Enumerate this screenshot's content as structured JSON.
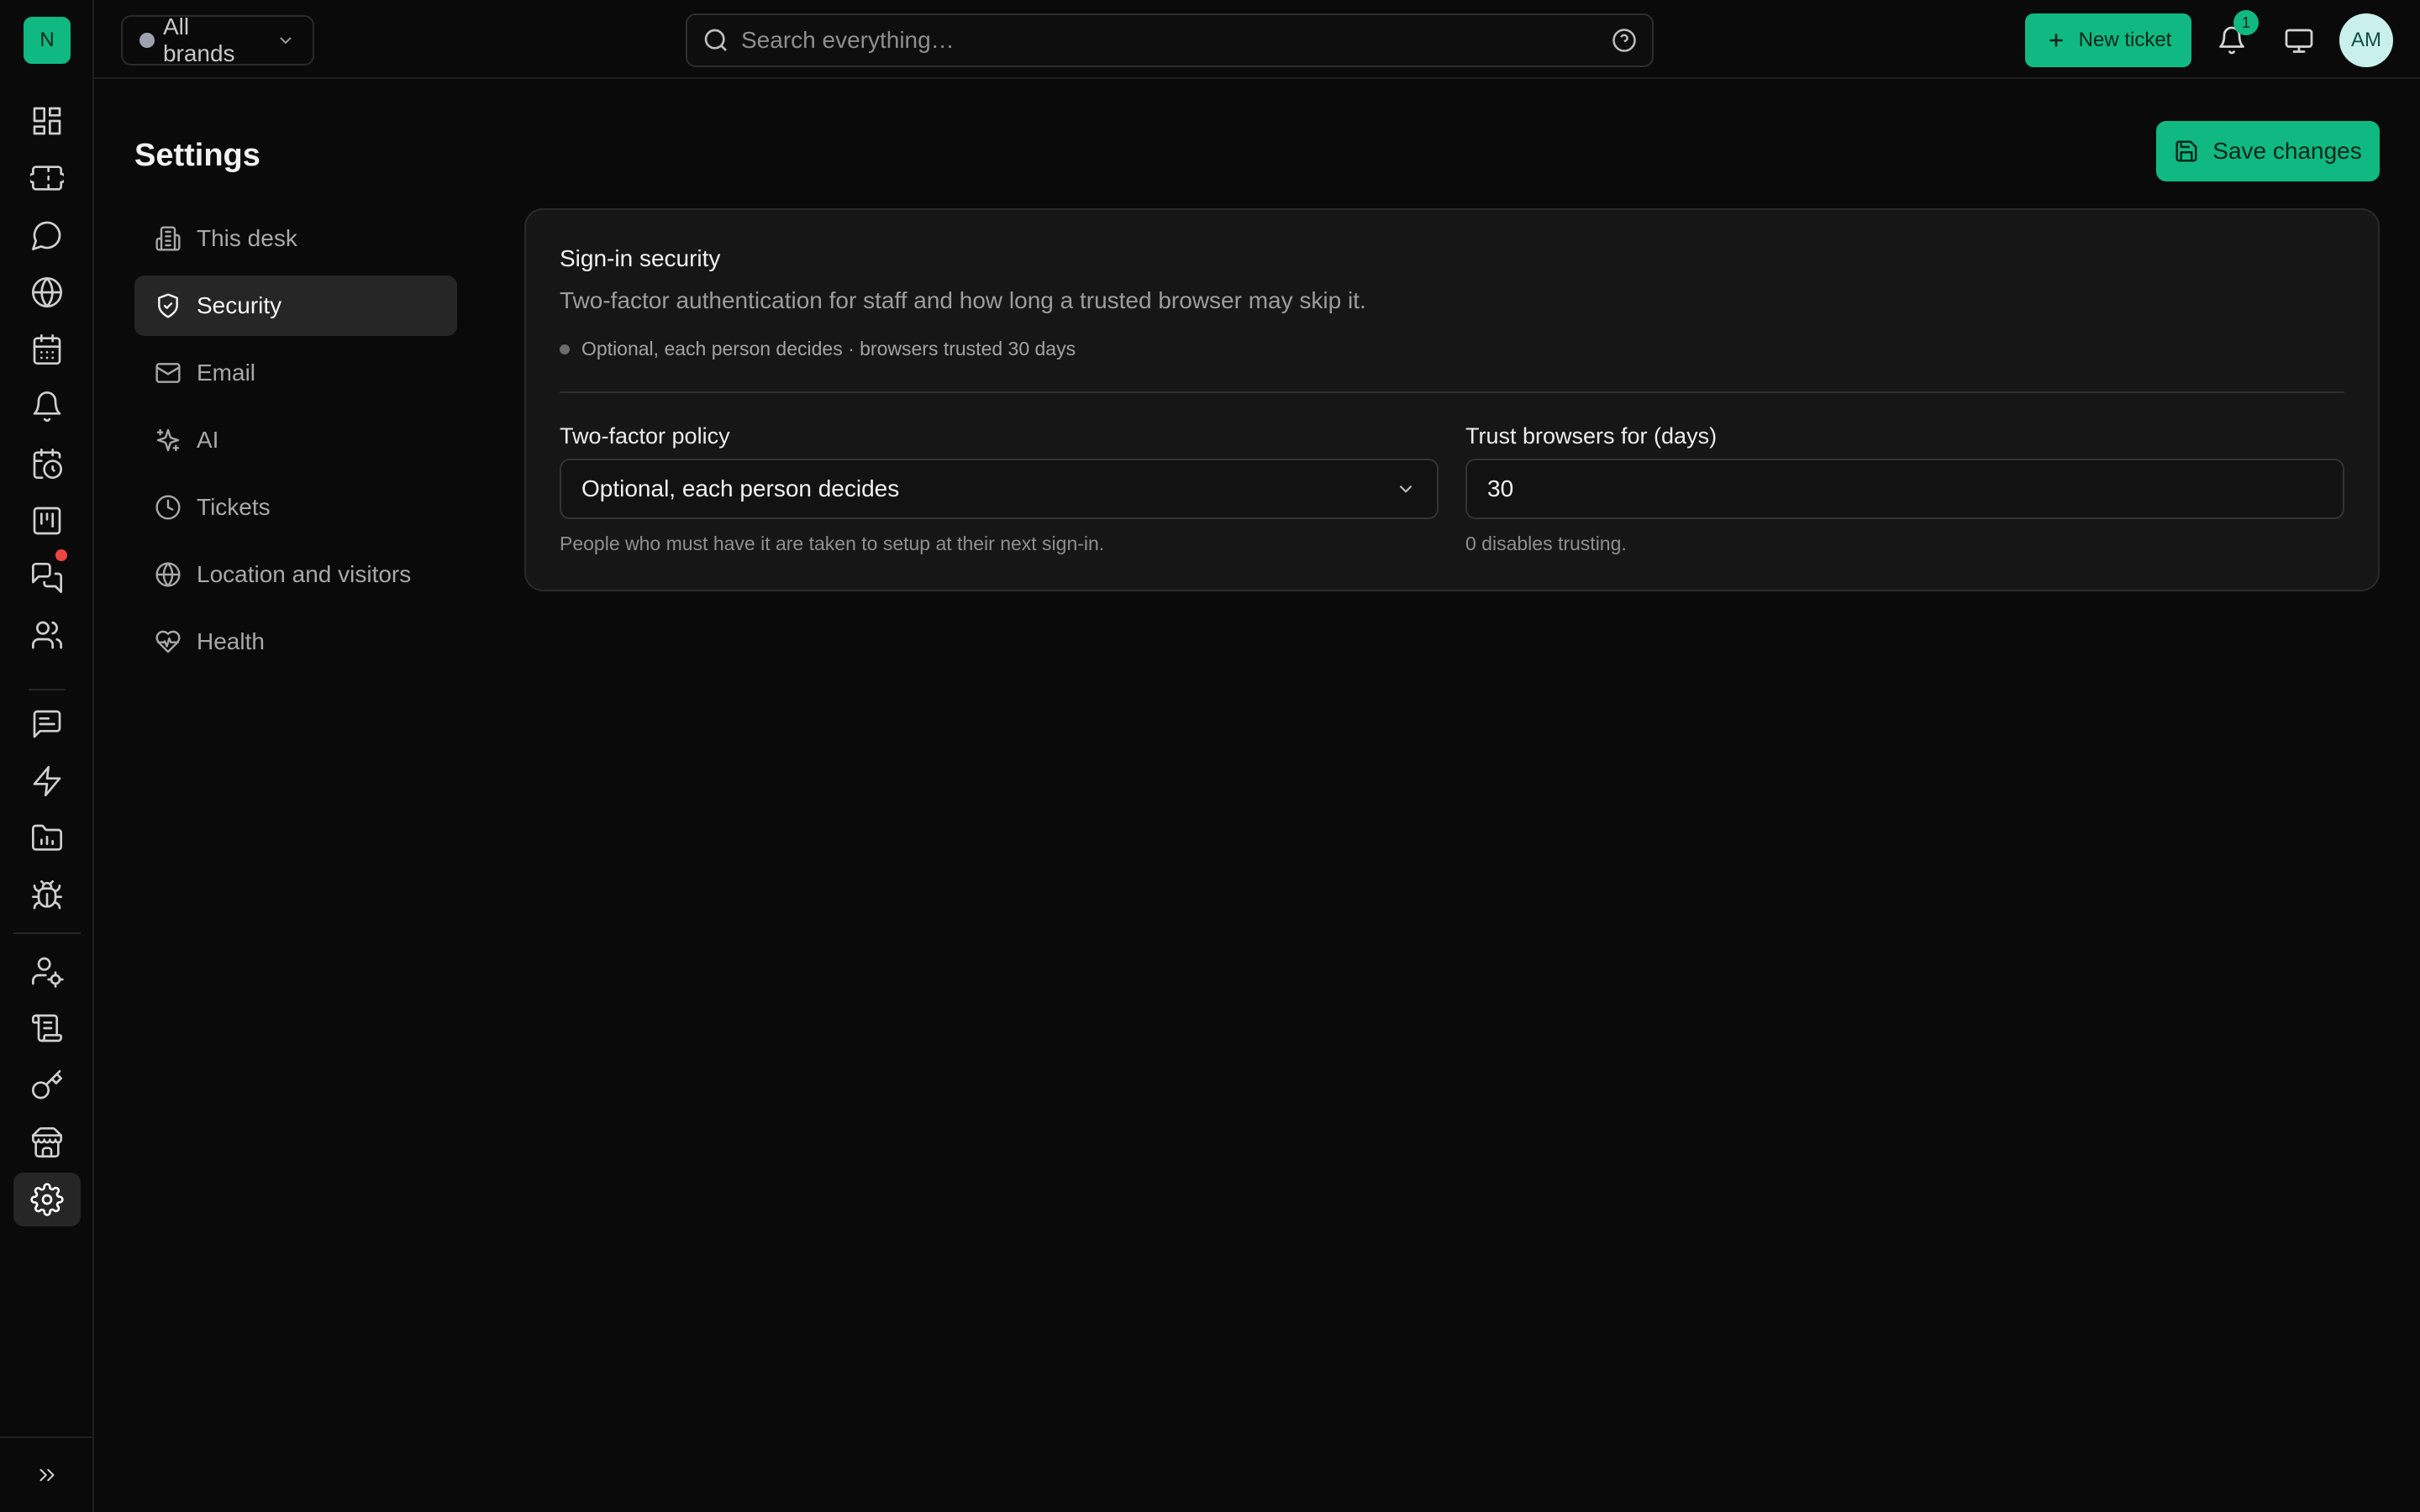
{
  "app": {
    "logo_letter": "N"
  },
  "topbar": {
    "brand_select": "All brands",
    "search_placeholder": "Search everything…",
    "new_ticket_label": "New ticket",
    "notification_count": "1",
    "avatar_initials": "AM"
  },
  "rail": {
    "items": [
      {
        "icon": "dashboard-icon"
      },
      {
        "icon": "ticket-icon"
      },
      {
        "icon": "chat-bubble-icon"
      },
      {
        "icon": "globe-icon"
      },
      {
        "icon": "calendar-icon"
      },
      {
        "icon": "bell-icon"
      },
      {
        "icon": "calendar-clock-icon"
      },
      {
        "icon": "kanban-icon"
      },
      {
        "icon": "messages-icon",
        "has_alert": true
      },
      {
        "icon": "users-icon"
      },
      {
        "icon": "message-square-text-icon"
      },
      {
        "icon": "zap-icon"
      },
      {
        "icon": "folder-chart-icon"
      },
      {
        "icon": "bug-icon"
      },
      {
        "icon": "user-cog-icon"
      },
      {
        "icon": "scroll-icon"
      },
      {
        "icon": "key-icon"
      },
      {
        "icon": "store-icon"
      },
      {
        "icon": "gear-icon",
        "active": true
      }
    ],
    "collapse_icon": "chevrons-right-icon"
  },
  "settings": {
    "title": "Settings",
    "save_label": "Save changes",
    "nav": [
      {
        "label": "This desk",
        "icon": "building-icon"
      },
      {
        "label": "Security",
        "icon": "shield-check-icon",
        "active": true
      },
      {
        "label": "Email",
        "icon": "mail-icon"
      },
      {
        "label": "AI",
        "icon": "sparkles-icon"
      },
      {
        "label": "Tickets",
        "icon": "clock-icon"
      },
      {
        "label": "Location and visitors",
        "icon": "globe-icon"
      },
      {
        "label": "Health",
        "icon": "heart-pulse-icon"
      }
    ]
  },
  "card": {
    "title": "Sign-in security",
    "description": "Two-factor authentication for staff and how long a trusted browser may skip it.",
    "status": "Optional, each person decides · browsers trusted 30 days",
    "two_factor": {
      "label": "Two-factor policy",
      "value": "Optional, each person decides",
      "help": "People who must have it are taken to setup at their next sign-in."
    },
    "trust": {
      "label": "Trust browsers for (days)",
      "value": "30",
      "help": "0 disables trusting."
    }
  },
  "colors": {
    "accent": "#10b981",
    "background": "#0a0a0a",
    "card": "#161616",
    "alert": "#ef4444"
  }
}
